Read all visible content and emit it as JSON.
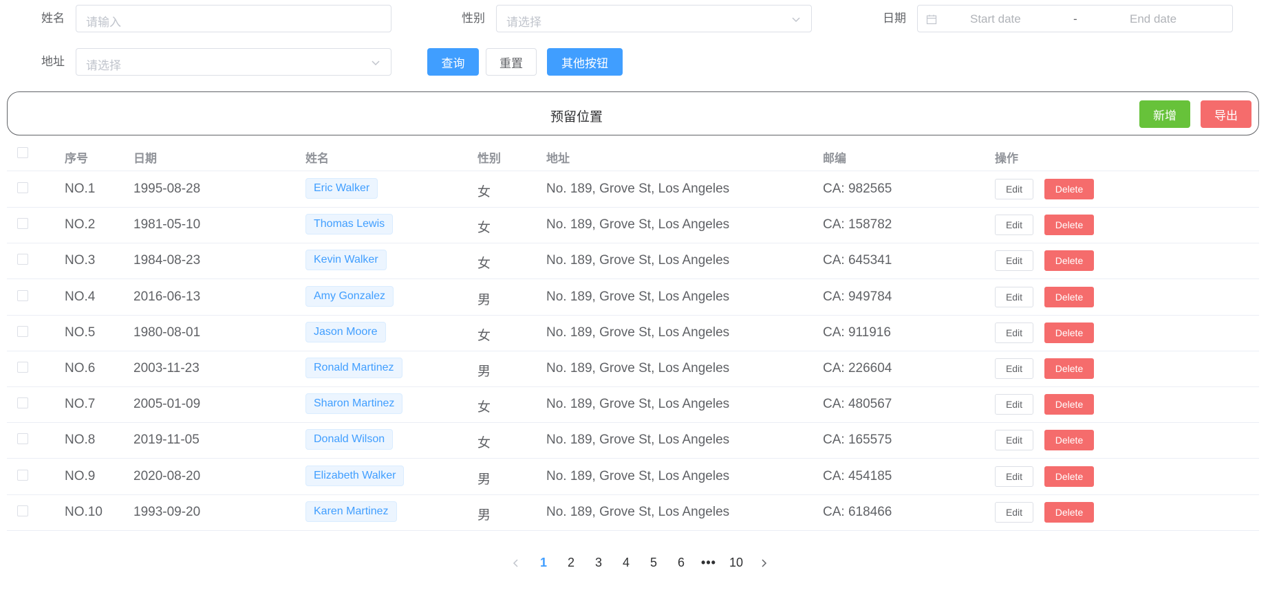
{
  "filters": {
    "name": {
      "label": "姓名",
      "placeholder": "请输入"
    },
    "gender": {
      "label": "性别",
      "placeholder": "请选择"
    },
    "date": {
      "label": "日期",
      "start_placeholder": "Start date",
      "separator": "-",
      "end_placeholder": "End date"
    },
    "address": {
      "label": "地址",
      "placeholder": "请选择"
    },
    "buttons": {
      "query": "查询",
      "reset": "重置",
      "other": "其他按钮"
    }
  },
  "reserved": {
    "text": "预留位置",
    "add_label": "新增",
    "export_label": "导出"
  },
  "table": {
    "columns": [
      "序号",
      "日期",
      "姓名",
      "性别",
      "地址",
      "邮编",
      "操作"
    ],
    "edit_label": "Edit",
    "delete_label": "Delete",
    "rows": [
      {
        "no": "NO.1",
        "date": "1995-08-28",
        "name": "Eric Walker",
        "gender": "女",
        "address": "No. 189, Grove St, Los Angeles",
        "zip": "CA: 982565"
      },
      {
        "no": "NO.2",
        "date": "1981-05-10",
        "name": "Thomas Lewis",
        "gender": "女",
        "address": "No. 189, Grove St, Los Angeles",
        "zip": "CA: 158782"
      },
      {
        "no": "NO.3",
        "date": "1984-08-23",
        "name": "Kevin Walker",
        "gender": "女",
        "address": "No. 189, Grove St, Los Angeles",
        "zip": "CA: 645341"
      },
      {
        "no": "NO.4",
        "date": "2016-06-13",
        "name": "Amy Gonzalez",
        "gender": "男",
        "address": "No. 189, Grove St, Los Angeles",
        "zip": "CA: 949784"
      },
      {
        "no": "NO.5",
        "date": "1980-08-01",
        "name": "Jason Moore",
        "gender": "女",
        "address": "No. 189, Grove St, Los Angeles",
        "zip": "CA: 911916"
      },
      {
        "no": "NO.6",
        "date": "2003-11-23",
        "name": "Ronald Martinez",
        "gender": "男",
        "address": "No. 189, Grove St, Los Angeles",
        "zip": "CA: 226604"
      },
      {
        "no": "NO.7",
        "date": "2005-01-09",
        "name": "Sharon Martinez",
        "gender": "女",
        "address": "No. 189, Grove St, Los Angeles",
        "zip": "CA: 480567"
      },
      {
        "no": "NO.8",
        "date": "2019-11-05",
        "name": "Donald Wilson",
        "gender": "女",
        "address": "No. 189, Grove St, Los Angeles",
        "zip": "CA: 165575"
      },
      {
        "no": "NO.9",
        "date": "2020-08-20",
        "name": "Elizabeth Walker",
        "gender": "男",
        "address": "No. 189, Grove St, Los Angeles",
        "zip": "CA: 454185"
      },
      {
        "no": "NO.10",
        "date": "1993-09-20",
        "name": "Karen Martinez",
        "gender": "男",
        "address": "No. 189, Grove St, Los Angeles",
        "zip": "CA: 618466"
      }
    ]
  },
  "pagination": {
    "pages": [
      "1",
      "2",
      "3",
      "4",
      "5",
      "6"
    ],
    "more": "•••",
    "last": "10",
    "current": "1"
  },
  "colors": {
    "primary": "#409eff",
    "success": "#67c23a",
    "danger": "#f56c6c"
  },
  "icons": {
    "calendar": "calendar-icon",
    "dropdown": "chevron-down-icon",
    "prev": "chevron-left-icon",
    "next": "chevron-right-icon"
  }
}
